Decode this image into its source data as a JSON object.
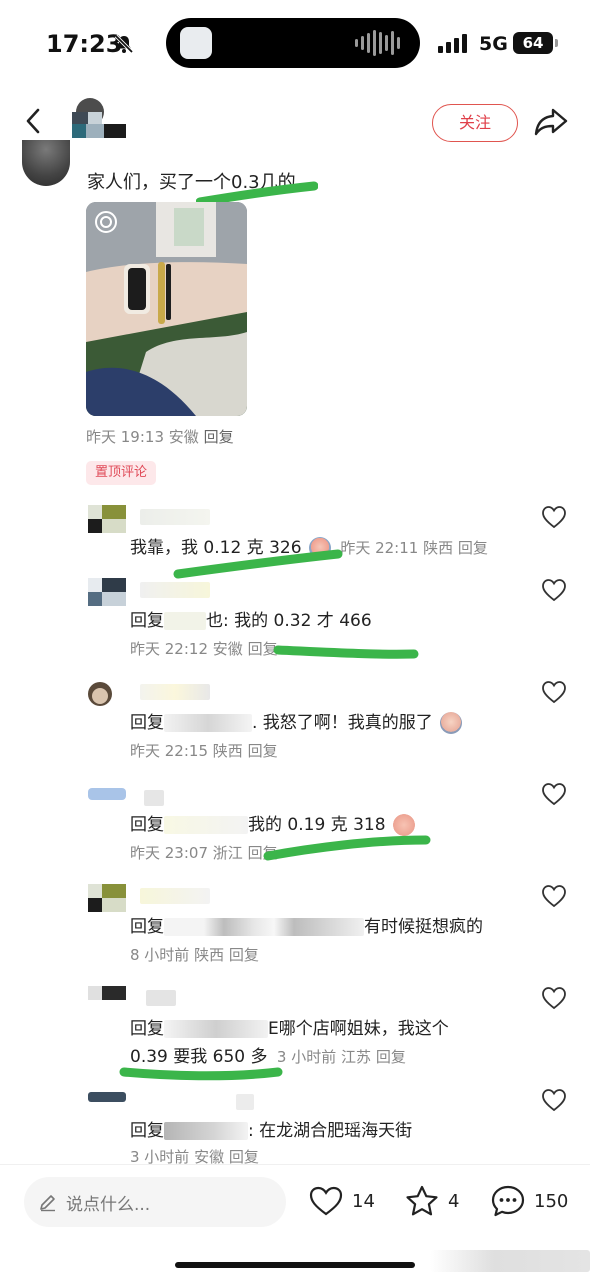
{
  "status_bar": {
    "time": "17:23",
    "network": "5G",
    "battery": "64"
  },
  "nav": {
    "follow_label": "关注"
  },
  "main_comment": {
    "text": "家人们，买了一个0.3几的",
    "time": "昨天 19:13",
    "location": "安徽",
    "reply_label": "回复"
  },
  "pinned_label": "置顶评论",
  "replies": [
    {
      "text_before": "我靠，我 0.12 克 326",
      "time": "昨天 22:11",
      "location": "陕西",
      "reply_label": "回复"
    },
    {
      "prefix": "回复",
      "text_after": "也: 我的 0.32 才 466",
      "time": "昨天 22:12",
      "location": "安徽",
      "reply_label": "回复"
    },
    {
      "prefix": "回复",
      "text_after": ". 我怒了啊！我真的服了",
      "time": "昨天 22:15",
      "location": "陕西",
      "reply_label": "回复"
    },
    {
      "prefix": "回复",
      "text_after": "我的 0.19 克 318",
      "time": "昨天 23:07",
      "location": "浙江",
      "reply_label": "回复"
    },
    {
      "prefix": "回复",
      "text_after": "有时候挺想疯的",
      "time": "8 小时前",
      "location": "陕西",
      "reply_label": "回复"
    },
    {
      "prefix": "回复",
      "text_after": "E哪个店啊姐妹，我这个",
      "line2": "0.39 要我 650 多",
      "time": "3 小时前",
      "location": "江苏",
      "reply_label": "回复"
    },
    {
      "prefix": "回复",
      "text_after": ": 在龙湖合肥瑶海天街",
      "time": "3 小时前",
      "location": "安徽",
      "reply_label": "回复"
    }
  ],
  "bottom_bar": {
    "input_placeholder": "说点什么...",
    "likes": "14",
    "favorites": "4",
    "comments": "150"
  },
  "colors": {
    "accent_red": "#e0404a",
    "highlight_green": "#3bb54a"
  }
}
